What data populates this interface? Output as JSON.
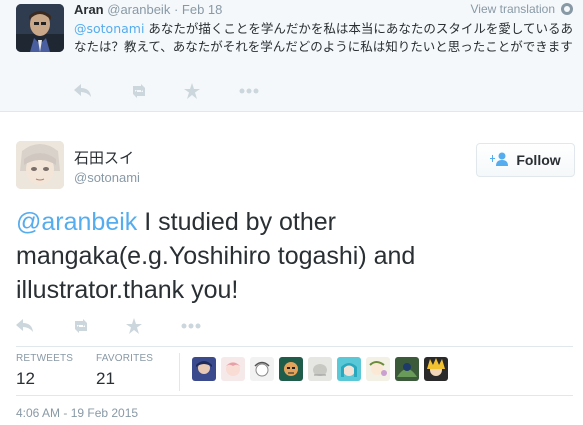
{
  "reply": {
    "name": "Aran",
    "handle": "@aranbeik",
    "separator": "·",
    "date": "Feb 18",
    "view_translation": "View translation",
    "mention": "@sotonami",
    "text": " あなたが描くことを学んだかを私は本当にあなたのスタイルを愛しているあなたは？教えて、あなたがそれを学んだどのように私は知りたいと思ったことができます"
  },
  "tweet": {
    "name": "石田スイ",
    "handle": "@sotonami",
    "follow_label": "Follow",
    "mention": "@aranbeik",
    "text": " I studied by other mangaka(e.g.Yoshihiro togashi) and illustrator.thank you!"
  },
  "stats": {
    "retweets_label": "RETWEETS",
    "retweets_value": "12",
    "favorites_label": "FAVORITES",
    "favorites_value": "21"
  },
  "timestamp": "4:06 AM - 19 Feb 2015",
  "icons": [
    "reply-icon",
    "retweet-icon",
    "favorite-icon",
    "more-icon",
    "globe-icon",
    "follow-person-icon"
  ],
  "colors": {
    "link": "#55acee",
    "muted": "#8899a6",
    "action": "#ccd6dd"
  }
}
